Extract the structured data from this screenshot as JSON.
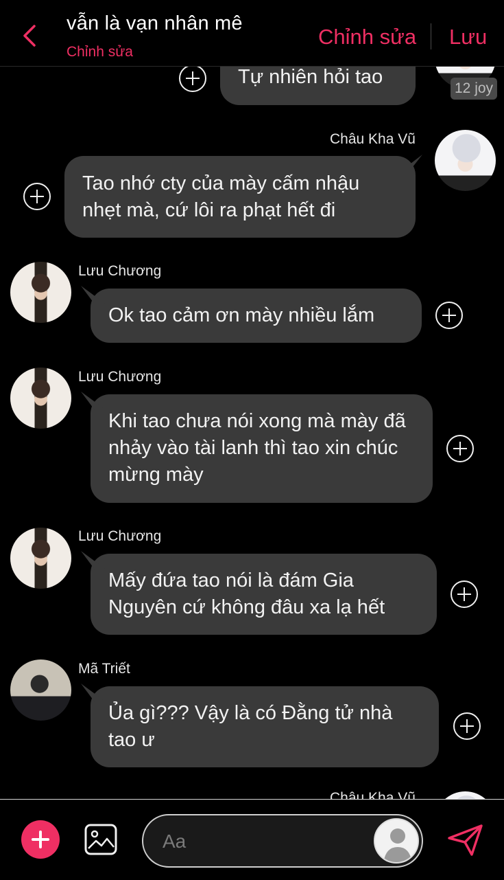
{
  "header": {
    "title": "vẫn là vạn nhân mê",
    "subtitle": "Chỉnh sửa",
    "edit_label": "Chỉnh sửa",
    "save_label": "Lưu"
  },
  "colors": {
    "accent": "#ef2f63",
    "bubble": "#3a3a3a",
    "background": "#000000"
  },
  "messages": [
    {
      "sender": "",
      "text": "Tự nhiên hỏi tao",
      "side": "right",
      "badge": "12 joy"
    },
    {
      "sender": "Châu Kha Vũ",
      "text": "Tao nhớ cty của mày cấm nhậu nhẹt mà, cứ lôi ra phạt hết đi",
      "side": "right"
    },
    {
      "sender": "Lưu Chương",
      "text": "Ok tao cảm ơn mày nhiều lắm",
      "side": "left"
    },
    {
      "sender": "Lưu Chương",
      "text": "Khi tao chưa nói xong mà mày đã nhảy vào tài lanh thì tao xin chúc mừng mày",
      "side": "left"
    },
    {
      "sender": "Lưu Chương",
      "text": "Mấy đứa tao nói là đám Gia Nguyên cứ không đâu xa lạ hết",
      "side": "left"
    },
    {
      "sender": "Mã Triết",
      "text": "Ủa gì??? Vậy là có Đằng tử nhà tao ư",
      "side": "left"
    },
    {
      "sender": "Châu Kha Vũ",
      "text": "",
      "side": "right"
    }
  ],
  "composer": {
    "placeholder": "Aa"
  },
  "icons": {
    "back": "chevron-left-icon",
    "add": "plus-icon",
    "gallery": "image-icon",
    "send": "send-icon",
    "add_reaction": "plus-circle-icon"
  }
}
